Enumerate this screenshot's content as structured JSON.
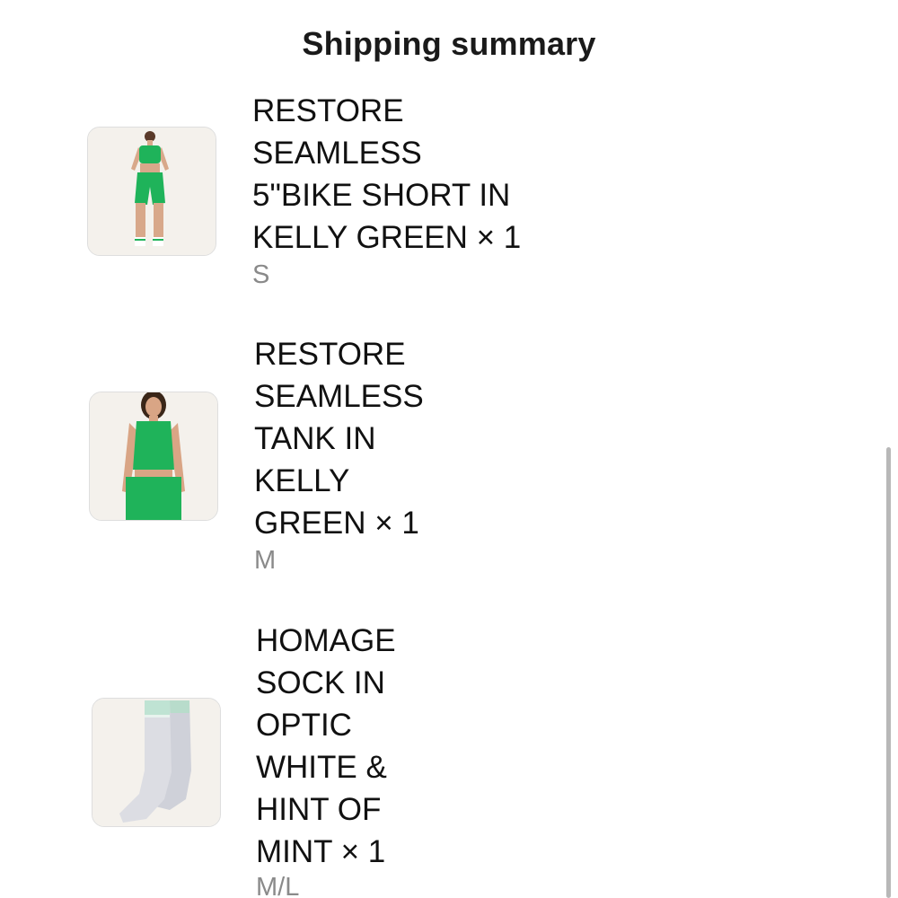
{
  "header": {
    "title": "Shipping summary"
  },
  "items": [
    {
      "name": "RESTORE\nSEAMLESS\n5\"BIKE SHORT IN\nKELLY GREEN × 1",
      "variant": "S",
      "thumbnail_icon": "bike-short-product-photo"
    },
    {
      "name": "RESTORE\nSEAMLESS\nTANK IN\nKELLY\nGREEN × 1",
      "variant": "M",
      "thumbnail_icon": "tank-product-photo"
    },
    {
      "name": "HOMAGE\nSOCK IN\nOPTIC\nWHITE &\nHINT OF\nMINT × 1",
      "variant": "M/L",
      "thumbnail_icon": "sock-product-photo"
    }
  ],
  "colors": {
    "accent_green": "#1fb35a",
    "variant_gray": "#8a8a8a",
    "sock_white": "#dcdde3",
    "sock_mint": "#bfe3d3"
  }
}
